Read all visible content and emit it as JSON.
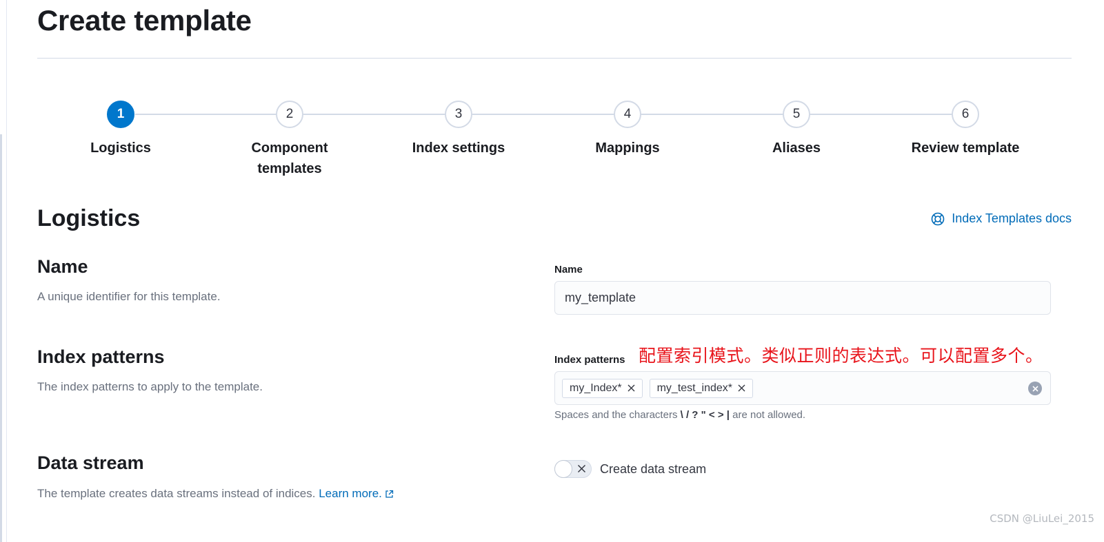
{
  "page": {
    "title": "Create template"
  },
  "stepper": {
    "steps": [
      {
        "number": "1",
        "label": "Logistics"
      },
      {
        "number": "2",
        "label": "Component templates"
      },
      {
        "number": "3",
        "label": "Index settings"
      },
      {
        "number": "4",
        "label": "Mappings"
      },
      {
        "number": "5",
        "label": "Aliases"
      },
      {
        "number": "6",
        "label": "Review template"
      }
    ],
    "active_step": 1
  },
  "logistics": {
    "title": "Logistics",
    "docs_link": "Index Templates docs",
    "name": {
      "title": "Name",
      "description": "A unique identifier for this template.",
      "field_label": "Name",
      "value": "my_template"
    },
    "index_patterns": {
      "title": "Index patterns",
      "description": "The index patterns to apply to the template.",
      "field_label": "Index patterns",
      "values": [
        "my_Index*",
        "my_test_index*"
      ],
      "help_prefix": "Spaces and the characters",
      "help_chars": "\\ / ? \" < > |",
      "help_suffix": "are not allowed."
    },
    "data_stream": {
      "title": "Data stream",
      "description": "The template creates data streams instead of indices.",
      "learn_more": "Learn more.",
      "toggle_label": "Create data stream",
      "enabled": false
    }
  },
  "annotation": "配置索引模式。类似正则的表达式。可以配置多个。",
  "watermark": "CSDN @LiuLei_2015",
  "colors": {
    "accent": "#0077cc",
    "link": "#006bb8",
    "annotation": "#e8141b"
  }
}
